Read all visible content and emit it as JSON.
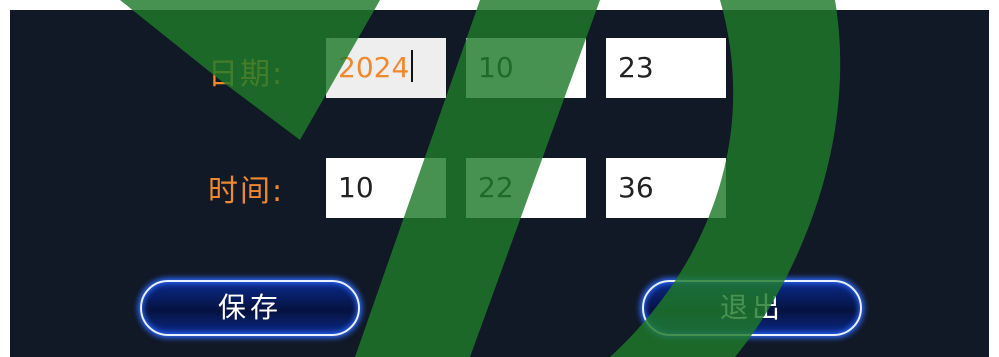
{
  "date_row": {
    "label": "日期:",
    "year": "2024",
    "month": "10",
    "day": "23"
  },
  "time_row": {
    "label": "时间:",
    "hour": "10",
    "minute": "22",
    "second": "36"
  },
  "buttons": {
    "save_label": "保存",
    "exit_label": "退出"
  },
  "colors": {
    "panel_background": "#111826",
    "label_orange": "#f0882e",
    "button_glow": "#2f6bff",
    "watermark_green": "#1e7a2a"
  }
}
